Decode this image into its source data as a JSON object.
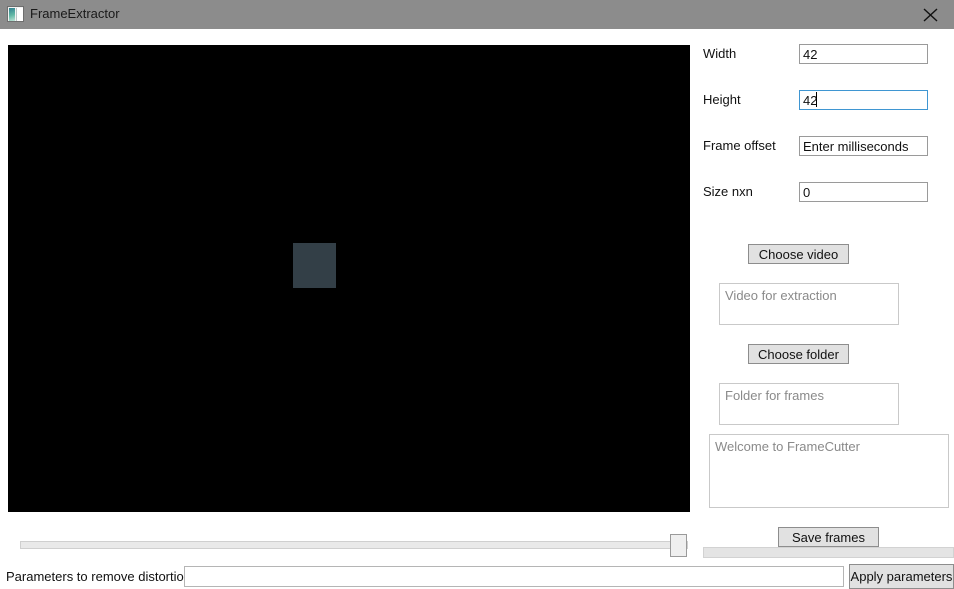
{
  "window": {
    "title": "FrameExtractor",
    "icon": "app-window-icon",
    "close_label": "✕",
    "titlebar_color": "#8c8c8c"
  },
  "preview": {
    "name": "video-preview",
    "background_color": "#000000",
    "marker_color": "#333f47"
  },
  "timeline": {
    "name": "timeline-slider",
    "value": 97,
    "min": 0,
    "max": 100
  },
  "form": {
    "fields": [
      {
        "label": "Width",
        "value": "42",
        "placeholder": "",
        "focused": false
      },
      {
        "label": "Height",
        "value": "42",
        "placeholder": "",
        "focused": true
      },
      {
        "label": "Frame offset",
        "value": "",
        "placeholder": "Enter milliseconds",
        "focused": false
      },
      {
        "label": "Size nxn",
        "value": "0",
        "placeholder": "",
        "focused": false
      }
    ]
  },
  "actions": {
    "choose_video": "Choose video",
    "choose_folder": "Choose folder",
    "save_frames": "Save frames",
    "apply_parameters": "Apply parameters"
  },
  "panes": {
    "video_path_placeholder": "Video for extraction",
    "video_path_value": "",
    "folder_path_placeholder": "Folder for frames",
    "folder_path_value": "",
    "log_placeholder": "Welcome to FrameCutter",
    "log_value": ""
  },
  "bottom": {
    "distortion_label": "Parameters to remove distortion",
    "distortion_value": "",
    "distortion_placeholder": ""
  }
}
